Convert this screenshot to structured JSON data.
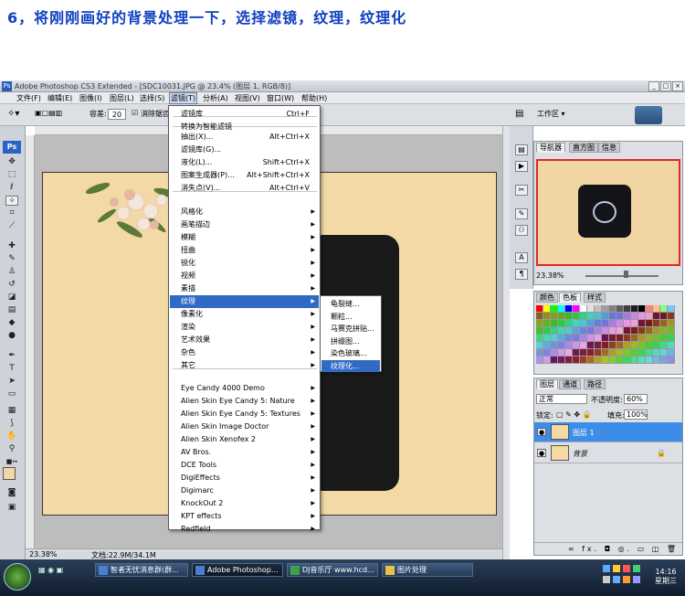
{
  "caption": "6，将刚刚画好的背景处理一下，选择滤镜，纹理，纹理化",
  "window": {
    "title": "Adobe Photoshop CS3 Extended - [SDC10031.JPG @ 23.4% (图层 1, RGB/8)]",
    "app_icon": "Ps"
  },
  "menubar": [
    "文件(F)",
    "编辑(E)",
    "图像(I)",
    "图层(L)",
    "选择(S)",
    "滤镜(T)",
    "分析(A)",
    "视图(V)",
    "窗口(W)",
    "帮助(H)"
  ],
  "options": {
    "tolerance_label": "容差:",
    "tolerance_value": "20",
    "antialias_label": "消除锯齿",
    "workspace_label": "工作区 ▾"
  },
  "toolbox": {
    "logo": "Ps"
  },
  "status": {
    "zoom": "23.38%",
    "doc": "文档:22.9M/34.1M"
  },
  "filter_menu": {
    "items": [
      {
        "label": "滤镜库",
        "shortcut": "Ctrl+F"
      },
      {
        "label": "转换为智能滤镜"
      },
      {
        "label": "抽出(X)...",
        "shortcut": "Alt+Ctrl+X"
      },
      {
        "label": "滤镜库(G)..."
      },
      {
        "label": "液化(L)...",
        "shortcut": "Shift+Ctrl+X"
      },
      {
        "label": "图案生成器(P)...",
        "shortcut": "Alt+Shift+Ctrl+X"
      },
      {
        "label": "消失点(V)...",
        "shortcut": "Alt+Ctrl+V"
      },
      {
        "label": "风格化"
      },
      {
        "label": "画笔描边"
      },
      {
        "label": "模糊"
      },
      {
        "label": "扭曲"
      },
      {
        "label": "锐化"
      },
      {
        "label": "视频"
      },
      {
        "label": "素描"
      },
      {
        "label": "纹理"
      },
      {
        "label": "像素化"
      },
      {
        "label": "渲染"
      },
      {
        "label": "艺术效果"
      },
      {
        "label": "杂色"
      },
      {
        "label": "其它"
      },
      {
        "label": "Eye Candy 4000 Demo"
      },
      {
        "label": "Alien Skin Eye Candy 5: Nature"
      },
      {
        "label": "Alien Skin Eye Candy 5: Textures"
      },
      {
        "label": "Alien Skin Image Doctor"
      },
      {
        "label": "Alien Skin Xenofex 2"
      },
      {
        "label": "AV Bros."
      },
      {
        "label": "DCE Tools"
      },
      {
        "label": "DigiEffects"
      },
      {
        "label": "Digimarc"
      },
      {
        "label": "KnockOut 2"
      },
      {
        "label": "KPT effects"
      },
      {
        "label": "Redfield"
      }
    ]
  },
  "texture_submenu": [
    "龟裂缝...",
    "颗粒...",
    "马赛克拼贴...",
    "拼缀图...",
    "染色玻璃...",
    "纹理化..."
  ],
  "navigator": {
    "tabs": [
      "导航器",
      "直方图",
      "信息"
    ],
    "zoom": "23.38%"
  },
  "swatches": {
    "tabs": [
      "颜色",
      "色板",
      "样式"
    ]
  },
  "layers": {
    "tabs": [
      "图层",
      "通道",
      "路径"
    ],
    "blend_mode": "正常",
    "opacity_label": "不透明度:",
    "opacity_value": "60%",
    "lock_label": "锁定:",
    "fill_label": "填充:",
    "fill_value": "100%",
    "rows": [
      {
        "name": "图层 1"
      },
      {
        "name": "背景"
      }
    ],
    "footer": "∞ fx. ◘ ◎. ▭ ◫ 🗑"
  },
  "taskbar": {
    "items": [
      "智者无忧消息群(群...",
      "Adobe Photoshop...",
      "DJ音乐厅 www.hcd...",
      "图片处理"
    ],
    "time": "14:16",
    "day": "星期三"
  }
}
